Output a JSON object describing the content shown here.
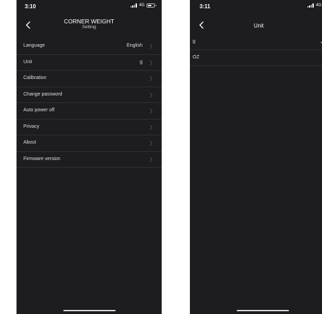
{
  "colors": {
    "background": "#ffffff",
    "screen": "#1d1d1f",
    "divider": "#2f2f31",
    "text": "#dedede",
    "chevron": "#4a4a4c"
  },
  "left_screen": {
    "status_bar": {
      "time": "3:10",
      "network": "4G"
    },
    "nav": {
      "back_icon": "chevron-left-icon",
      "title": "CORNER WEIGHT",
      "subtitle": "Setting"
    },
    "items": [
      {
        "label": "Language",
        "value": "English"
      },
      {
        "label": "Unit",
        "value": "g"
      },
      {
        "label": "Calibration",
        "value": ""
      },
      {
        "label": "Change password",
        "value": ""
      },
      {
        "label": "Auto power off",
        "value": ""
      },
      {
        "label": "Privacy",
        "value": ""
      },
      {
        "label": "About",
        "value": ""
      },
      {
        "label": "Firmware version",
        "value": ""
      }
    ]
  },
  "right_screen": {
    "status_bar": {
      "time": "3:11",
      "network": "4G"
    },
    "nav": {
      "back_icon": "chevron-left-icon",
      "title": "Unit"
    },
    "options": [
      {
        "label": "g",
        "selected": true
      },
      {
        "label": "OZ",
        "selected": false
      }
    ]
  }
}
